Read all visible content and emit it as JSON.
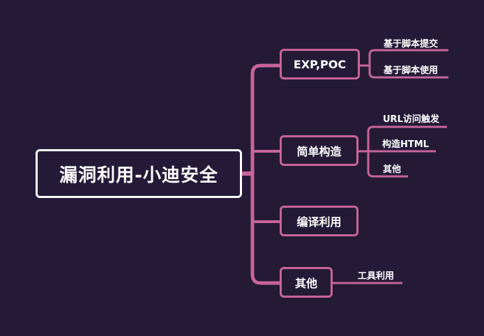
{
  "mindmap": {
    "root": "漏洞利用-小迪安全",
    "branches": [
      {
        "label": "EXP,POC",
        "children": [
          "基于脚本提交",
          "基于脚本使用"
        ]
      },
      {
        "label": "简单构造",
        "children": [
          "URL访问触发",
          "构造HTML",
          "其他"
        ]
      },
      {
        "label": "编译利用",
        "children": []
      },
      {
        "label": "其他",
        "children": [
          "工具利用"
        ]
      }
    ]
  },
  "colors": {
    "background": "#241a38",
    "connector": "#c9649c",
    "root_border": "#ffffff",
    "text": "#ffffff"
  }
}
